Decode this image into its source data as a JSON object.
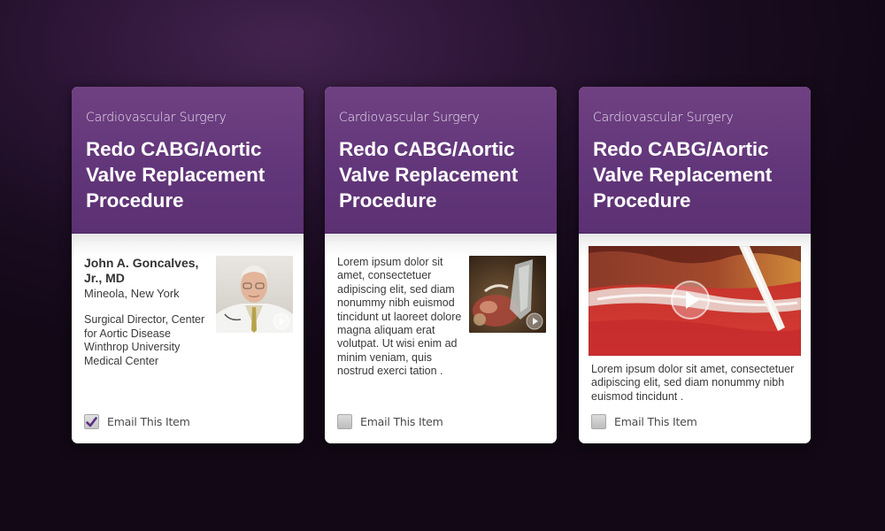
{
  "cards": [
    {
      "category": "Cardiovascular Surgery",
      "title": "Redo CABG/Aortic Valve Replacement Procedure",
      "doctor_name": "John A. Goncalves, Jr., MD",
      "doctor_location": "Mineola, New York",
      "doctor_role": "Surgical Director, Center for Aortic Disease Winthrop University Medical Center",
      "email_label": "Email This Item",
      "email_checked": true
    },
    {
      "category": "Cardiovascular Surgery",
      "title": "Redo CABG/Aortic Valve Replacement Procedure",
      "description": "Lorem ipsum dolor sit amet, consectetuer adipiscing elit, sed diam nonummy nibh euismod tincidunt ut laoreet dolore magna aliquam erat volutpat. Ut wisi enim ad minim veniam, quis nostrud exerci tation .",
      "email_label": "Email This Item",
      "email_checked": false
    },
    {
      "category": "Cardiovascular Surgery",
      "title": "Redo CABG/Aortic Valve Replacement Procedure",
      "description": "Lorem ipsum dolor sit amet, consectetuer adipiscing elit, sed diam nonummy nibh euismod tincidunt .",
      "email_label": "Email This Item",
      "email_checked": false
    }
  ],
  "colors": {
    "header_purple": "#62367a",
    "checkmark_purple": "#5a2e82"
  },
  "icons": [
    "play-icon",
    "checkmark-icon"
  ]
}
